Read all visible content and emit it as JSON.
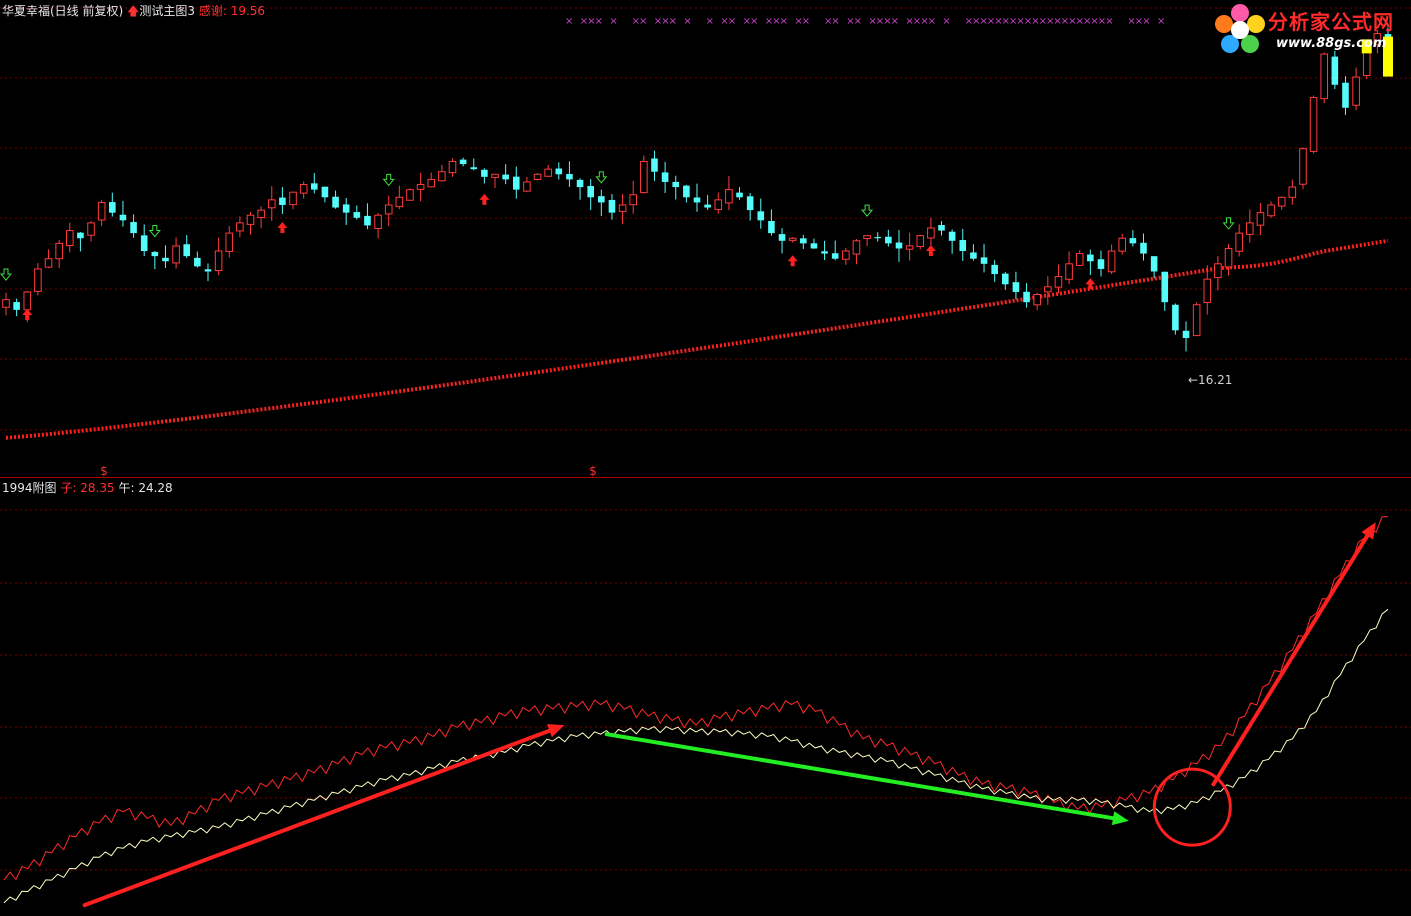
{
  "header": {
    "stock_name": "华夏幸福(日线 前复权)",
    "indicator_name": "测试主图3",
    "thanks_label": "感谢",
    "thanks_value": "19.56"
  },
  "sub_header": {
    "indicator_name": "1994附图",
    "zi_label": "子",
    "zi_value": "28.35",
    "wu_label": "午",
    "wu_value": "24.28"
  },
  "logo": {
    "brand": "分析家公式网",
    "url": "www.88gs.com"
  },
  "chart_data": [
    {
      "type": "candlestick",
      "price_annotation": "16.21",
      "dollar_markers": [
        "$",
        "$"
      ],
      "colors": {
        "up": "#ff3b3b",
        "down": "#54fcfc",
        "ma": "#ff2020",
        "grid": "#7a0000"
      },
      "ma_start": 13.2,
      "ma_end": 20.9,
      "closes": [
        18.6,
        18.2,
        18.9,
        19.8,
        20.2,
        20.8,
        21.3,
        21.0,
        21.6,
        22.4,
        22.0,
        21.7,
        21.2,
        20.5,
        20.3,
        20.1,
        20.7,
        20.3,
        19.9,
        19.7,
        20.5,
        21.2,
        21.6,
        21.9,
        22.1,
        22.5,
        22.3,
        22.8,
        23.1,
        22.9,
        22.6,
        22.2,
        22.0,
        21.8,
        21.5,
        21.9,
        22.3,
        22.6,
        22.9,
        23.1,
        23.3,
        23.6,
        24.0,
        23.9,
        23.7,
        23.4,
        23.5,
        23.3,
        22.9,
        23.2,
        23.5,
        23.7,
        23.5,
        23.3,
        23.0,
        22.6,
        22.4,
        22.0,
        22.3,
        22.7,
        24.0,
        23.6,
        23.2,
        23.0,
        22.6,
        22.4,
        22.2,
        22.5,
        22.9,
        22.6,
        22.1,
        21.7,
        21.2,
        20.9,
        21.0,
        20.8,
        20.6,
        20.4,
        20.2,
        20.5,
        20.9,
        21.1,
        21.0,
        20.8,
        20.6,
        20.7,
        21.1,
        21.4,
        21.3,
        20.9,
        20.5,
        20.2,
        20.0,
        19.6,
        19.2,
        18.9,
        18.5,
        18.8,
        19.1,
        19.5,
        20.0,
        20.4,
        20.1,
        19.8,
        20.5,
        21.0,
        20.8,
        20.4,
        19.7,
        18.5,
        17.4,
        17.1,
        18.4,
        19.4,
        20.0,
        20.6,
        21.2,
        21.6,
        22.0,
        22.3,
        22.6,
        23.0,
        24.5,
        26.5,
        28.2,
        27.0,
        26.1,
        27.3,
        28.5,
        29.0,
        28.1
      ],
      "signals": [
        {
          "index": 0,
          "type": "down-arrow"
        },
        {
          "index": 2,
          "type": "up-arrow"
        },
        {
          "index": 14,
          "type": "down-arrow"
        },
        {
          "index": 26,
          "type": "up-arrow"
        },
        {
          "index": 36,
          "type": "down-arrow"
        },
        {
          "index": 45,
          "type": "up-arrow"
        },
        {
          "index": 56,
          "type": "down-arrow"
        },
        {
          "index": 74,
          "type": "up-arrow"
        },
        {
          "index": 81,
          "type": "down-arrow"
        },
        {
          "index": 87,
          "type": "up-arrow"
        },
        {
          "index": 102,
          "type": "up-arrow"
        },
        {
          "index": 115,
          "type": "down-arrow"
        },
        {
          "index": 131,
          "type": "up-arrow"
        },
        {
          "index": 144,
          "type": "down-arrow"
        },
        {
          "index": 151,
          "type": "up-arrow"
        }
      ],
      "highlight_bars": [
        128,
        130,
        149
      ],
      "top_marks": "× ××× ×  ×× ××× ×  × ×× ×× ××× ××  ×× ×× ×××× ×××× ×  ××××××××××××××××××××  ××× ×"
    },
    {
      "type": "line",
      "series": [
        {
          "name": "子",
          "color": "#ff2a2a",
          "values": [
            12.4,
            12.9,
            13.6,
            14.3,
            14.9,
            15.4,
            15.1,
            14.8,
            15.3,
            15.9,
            16.2,
            16.5,
            16.8,
            17.1,
            17.5,
            17.9,
            18.2,
            18.4,
            18.7,
            19.1,
            19.3,
            19.6,
            19.8,
            19.9,
            20.0,
            20.1,
            19.9,
            19.6,
            19.4,
            19.2,
            19.5,
            19.7,
            19.9,
            20.1,
            19.8,
            19.2,
            18.6,
            18.3,
            17.9,
            17.5,
            17.0,
            16.6,
            16.4,
            16.2,
            15.8,
            15.5,
            15.6,
            15.9,
            16.2,
            16.8,
            17.5,
            18.3,
            19.6,
            21.0,
            22.5,
            24.1,
            25.8,
            27.4,
            28.35
          ]
        },
        {
          "name": "午",
          "color": "#ffffc0",
          "values": [
            11.4,
            11.9,
            12.4,
            12.9,
            13.4,
            13.8,
            14.1,
            14.3,
            14.5,
            14.7,
            15.0,
            15.3,
            15.6,
            15.9,
            16.2,
            16.5,
            16.8,
            17.0,
            17.3,
            17.6,
            17.8,
            18.0,
            18.3,
            18.5,
            18.7,
            18.8,
            18.9,
            19.0,
            19.0,
            18.9,
            18.9,
            18.8,
            18.7,
            18.5,
            18.2,
            18.0,
            17.8,
            17.6,
            17.3,
            17.0,
            16.7,
            16.4,
            16.2,
            16.0,
            15.9,
            15.9,
            15.8,
            15.6,
            15.4,
            15.5,
            15.8,
            16.3,
            16.9,
            17.7,
            18.6,
            19.8,
            21.4,
            22.9,
            24.28
          ]
        }
      ],
      "annotations": [
        {
          "type": "arrow",
          "color": "#ff2020",
          "from": [
            0.06,
            11.3
          ],
          "to": [
            0.4,
            19.2
          ]
        },
        {
          "type": "arrow",
          "color": "#22ee22",
          "from": [
            0.43,
            18.8
          ],
          "to": [
            0.8,
            15.0
          ]
        },
        {
          "type": "circle",
          "color": "#ff2020",
          "center": [
            0.845,
            15.6
          ]
        },
        {
          "type": "arrow",
          "color": "#ff2020",
          "from": [
            0.86,
            16.6
          ],
          "to": [
            0.975,
            28.1
          ]
        }
      ]
    }
  ]
}
